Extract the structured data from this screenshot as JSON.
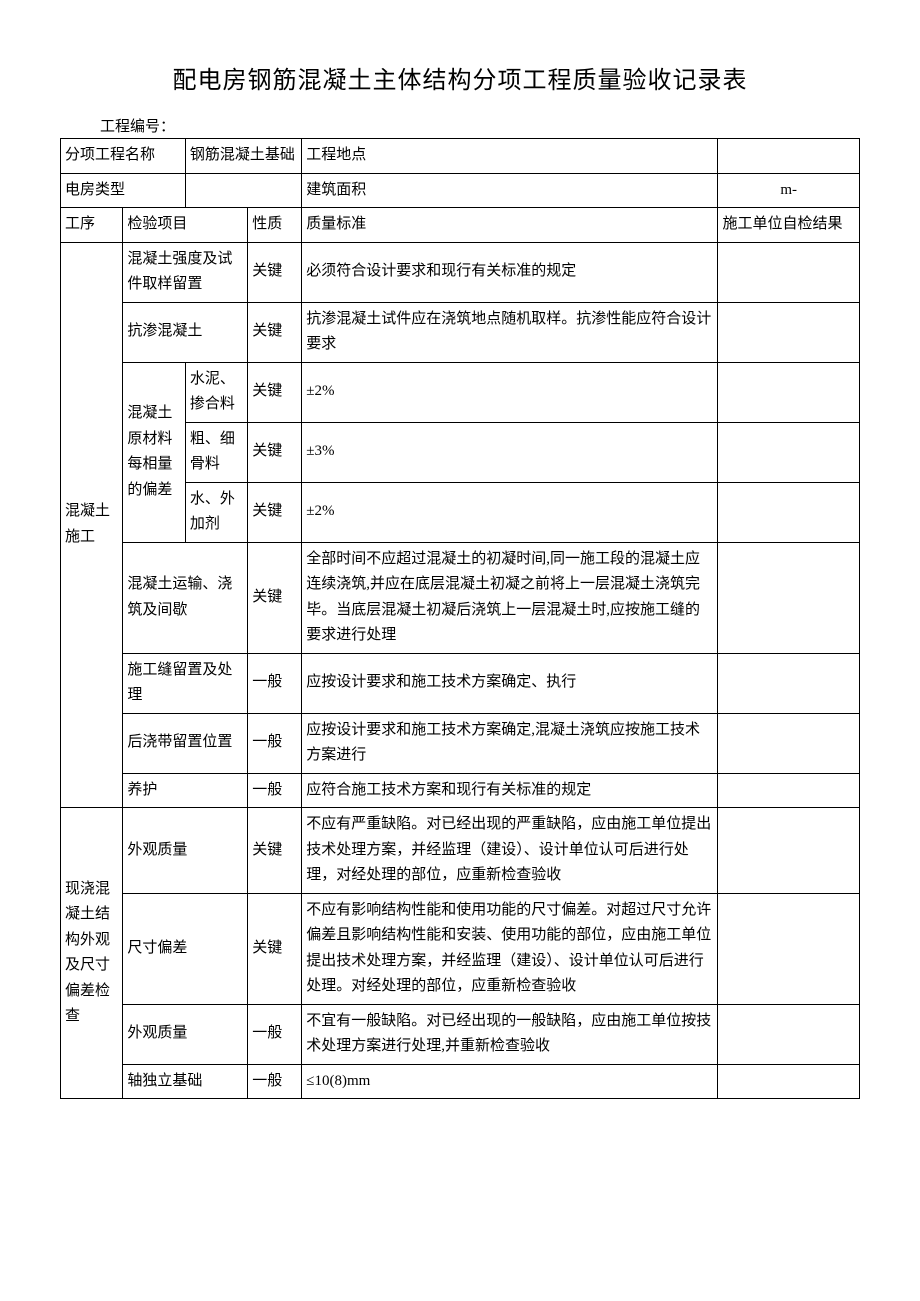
{
  "title": "配电房钢筋混凝土主体结构分项工程质量验收记录表",
  "proj_no_label": "工程编号：",
  "header": {
    "sub_name_label": "分项工程名称",
    "sub_name_value": "钢筋混凝土基础",
    "location_label": "工程地点",
    "location_value": "",
    "type_label": "电房类型",
    "type_value": "",
    "area_label": "建筑面积",
    "area_value": "m-"
  },
  "cols": {
    "proc": "工序",
    "item": "检验项目",
    "nature": "性质",
    "std": "质量标准",
    "result": "施工单位自检结果"
  },
  "proc": {
    "conc": "混凝土施工",
    "cast": "现浇混凝土结构外观及尺寸偏差检查"
  },
  "group_mat": "混凝土原材料每相量的偏差",
  "rows": {
    "r1": {
      "item": "混凝土强度及试件取样留置",
      "nature": "关键",
      "std": "必须符合设计要求和现行有关标准的规定"
    },
    "r2": {
      "item": "抗渗混凝土",
      "nature": "关键",
      "std": "抗渗混凝土试件应在浇筑地点随机取样。抗渗性能应符合设计要求"
    },
    "r3": {
      "item": "水泥、掺合料",
      "nature": "关键",
      "std": "±2%"
    },
    "r4": {
      "item": "粗、细骨料",
      "nature": "关键",
      "std": "±3%"
    },
    "r5": {
      "item": "水、外加剂",
      "nature": "关键",
      "std": "±2%"
    },
    "r6": {
      "item": "混凝土运输、浇筑及间歇",
      "nature": "关键",
      "std": "全部时间不应超过混凝土的初凝时间,同一施工段的混凝土应连续浇筑,并应在底层混凝土初凝之前将上一层混凝土浇筑完毕。当底层混凝土初凝后浇筑上一层混凝土时,应按施工缝的要求进行处理"
    },
    "r7": {
      "item": "施工缝留置及处理",
      "nature": "一般",
      "std": "应按设计要求和施工技术方案确定、执行"
    },
    "r8": {
      "item": "后浇带留置位置",
      "nature": "一般",
      "std": "应按设计要求和施工技术方案确定,混凝土浇筑应按施工技术方案进行"
    },
    "r9": {
      "item": "养护",
      "nature": "一般",
      "std": "应符合施工技术方案和现行有关标准的规定"
    },
    "r10": {
      "item": "外观质量",
      "nature": "关键",
      "std": "不应有严重缺陷。对已经出现的严重缺陷，应由施工单位提出技术处理方案，并经监理（建设）、设计单位认可后进行处理，对经处理的部位，应重新检查验收"
    },
    "r11": {
      "item": "尺寸偏差",
      "nature": "关键",
      "std": "不应有影响结构性能和使用功能的尺寸偏差。对超过尺寸允许偏差且影响结构性能和安装、使用功能的部位，应由施工单位提出技术处理方案，并经监理（建设）、设计单位认可后进行处理。对经处理的部位，应重新检查验收"
    },
    "r12": {
      "item": "外观质量",
      "nature": "一般",
      "std": "不宜有一般缺陷。对已经出现的一般缺陷，应由施工单位按技术处理方案进行处理,并重新检查验收"
    },
    "r13": {
      "item": "轴独立基础",
      "nature": "一般",
      "std": "≤10(8)mm"
    }
  }
}
